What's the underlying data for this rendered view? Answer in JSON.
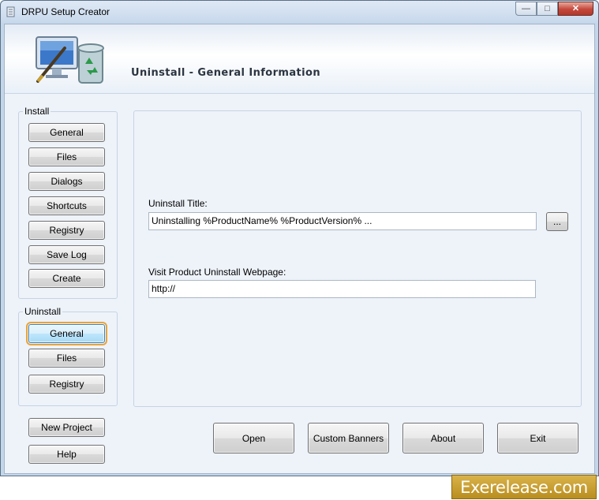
{
  "window": {
    "title": "DRPU Setup Creator",
    "minimize_glyph": "—",
    "maximize_glyph": "□",
    "close_glyph": "✕"
  },
  "banner": {
    "title": "Uninstall - General Information",
    "icons": [
      "monitor-pen-icon",
      "recycle-bin-icon"
    ]
  },
  "install_group": {
    "label": "Install",
    "buttons": [
      "General",
      "Files",
      "Dialogs",
      "Shortcuts",
      "Registry",
      "Save Log",
      "Create"
    ]
  },
  "uninstall_group": {
    "label": "Uninstall",
    "buttons": [
      "General",
      "Files",
      "Registry"
    ],
    "active": "General"
  },
  "project_buttons": {
    "new_project": "New Project",
    "help": "Help"
  },
  "form": {
    "uninstall_title_label": "Uninstall Title:",
    "uninstall_title_value": "Uninstalling %ProductName% %ProductVersion% ...",
    "browse_label": "...",
    "webpage_label": "Visit Product Uninstall Webpage:",
    "webpage_value": "http://"
  },
  "footer_buttons": {
    "open": "Open",
    "custom_banners": "Custom Banners",
    "about": "About",
    "exit": "Exit"
  },
  "watermark": "Exerelease.com",
  "colors": {
    "accent_focus": "#e8a43a",
    "window_background": "#eef3fa",
    "watermark_gold": "#c9a030"
  }
}
